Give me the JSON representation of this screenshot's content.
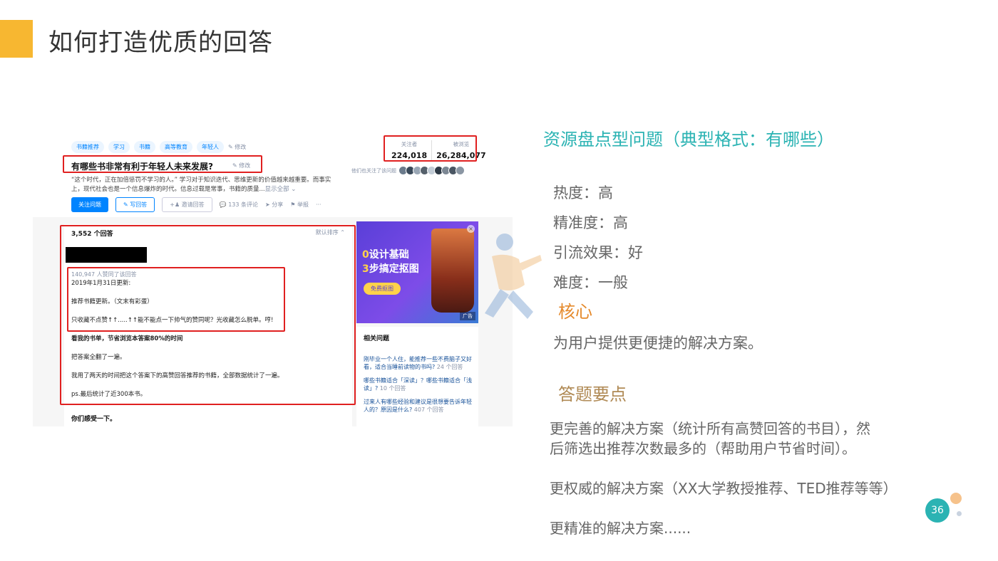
{
  "slide": {
    "title": "如何打造优质的回答",
    "page_number": "36"
  },
  "screenshot": {
    "tags": [
      "书籍推荐",
      "学习",
      "书籍",
      "高等教育",
      "年轻人"
    ],
    "tags_edit": "修改",
    "question_title": "有哪些书非常有利于年轻人未来发展?",
    "question_edit": "修改",
    "description_line1": "“这个时代，正在加倍惩罚不学习的人。”  学习对于知识迭代、思维更新的价值越来越重要。而事实",
    "description_line2": "上，现代社会也是一个信息爆炸的时代。信息过载是常事，书籍的质量...",
    "description_more": "显示全部 ⌄",
    "actions": {
      "follow": "关注问题",
      "write": "写回答",
      "invite": "邀请回答",
      "comments": "133 条评论",
      "share": "分享",
      "report": "举报",
      "more": "···"
    },
    "stats": {
      "followers_label": "关注者",
      "followers_value": "224,018",
      "views_label": "被浏览",
      "views_value": "26,284,077"
    },
    "followers_also": "他们也关注了该问题",
    "avatar_colors": [
      "#6b7b8c",
      "#3a4a5a",
      "#9aa7b5",
      "#55606b",
      "#c2ccd6",
      "#2e3a46",
      "#7d8894",
      "#4a5663",
      "#8a96a3"
    ],
    "answers_count": "3,552 个回答",
    "sort_label": "默认排序 ⌃",
    "answer": {
      "votes": "140,947 人赞同了该回答",
      "update": "2019年1月31日更新:",
      "line1": "推荐书籍更新。（文末有彩蛋）",
      "line2": "只收藏不点赞↑↑.....↑↑能不能点一下帅气的赞同呢？光收藏怎么脱单。哼!",
      "line3": "看我的书单，节省浏览本答案80%的时间",
      "line4": "把答案全翻了一遍。",
      "line5": "我用了两天的时间把这个答案下的高赞回答推荐的书籍，全部数据统计了一遍。",
      "line6": "ps.最后统计了近300本书。",
      "line7": "你们感受一下。"
    },
    "ad": {
      "line1_highlight": "0",
      "line1_rest": "设计基础",
      "line2_highlight": "3",
      "line2_rest": "步搞定抠图",
      "button": "免费抠图",
      "close": "×",
      "tag": "广告"
    },
    "related": {
      "title": "相关问题",
      "items": [
        {
          "text": "刚毕业一个人住，能推荐一些不费脑子又好看，适合当睡前读物的书吗?",
          "count": "24 个回答"
        },
        {
          "text": "哪些书籍适合「深读」？哪些书籍适合「浅读」?",
          "count": "10 个回答"
        },
        {
          "text": "过来人有哪些经验和建议是很想要告诉年轻人的？原因是什么?",
          "count": "407 个回答"
        }
      ]
    }
  },
  "right_panel": {
    "heading": "资源盘点型问题（典型格式：有哪些）",
    "properties": [
      "热度：高",
      "精准度：高",
      "引流效果：好",
      "难度：一般"
    ],
    "core_heading": "核心",
    "core_text": "为用户提供更便捷的解决方案。",
    "tips_heading": "答题要点",
    "tip1_line1": "更完善的解决方案（统计所有高赞回答的书目），然",
    "tip1_line2": "后筛选出推荐次数最多的（帮助用户节省时间）。",
    "tip2": "更权威的解决方案（XX大学教授推荐、TED推荐等等）",
    "tip3": "更精准的解决方案......"
  },
  "colors": {
    "accent_yellow": "#f7b731",
    "teal": "#2bb3b3",
    "orange": "#e58a2c",
    "gold": "#b08a55",
    "zhihu_blue": "#0084ff",
    "highlight_red": "#e02020"
  }
}
